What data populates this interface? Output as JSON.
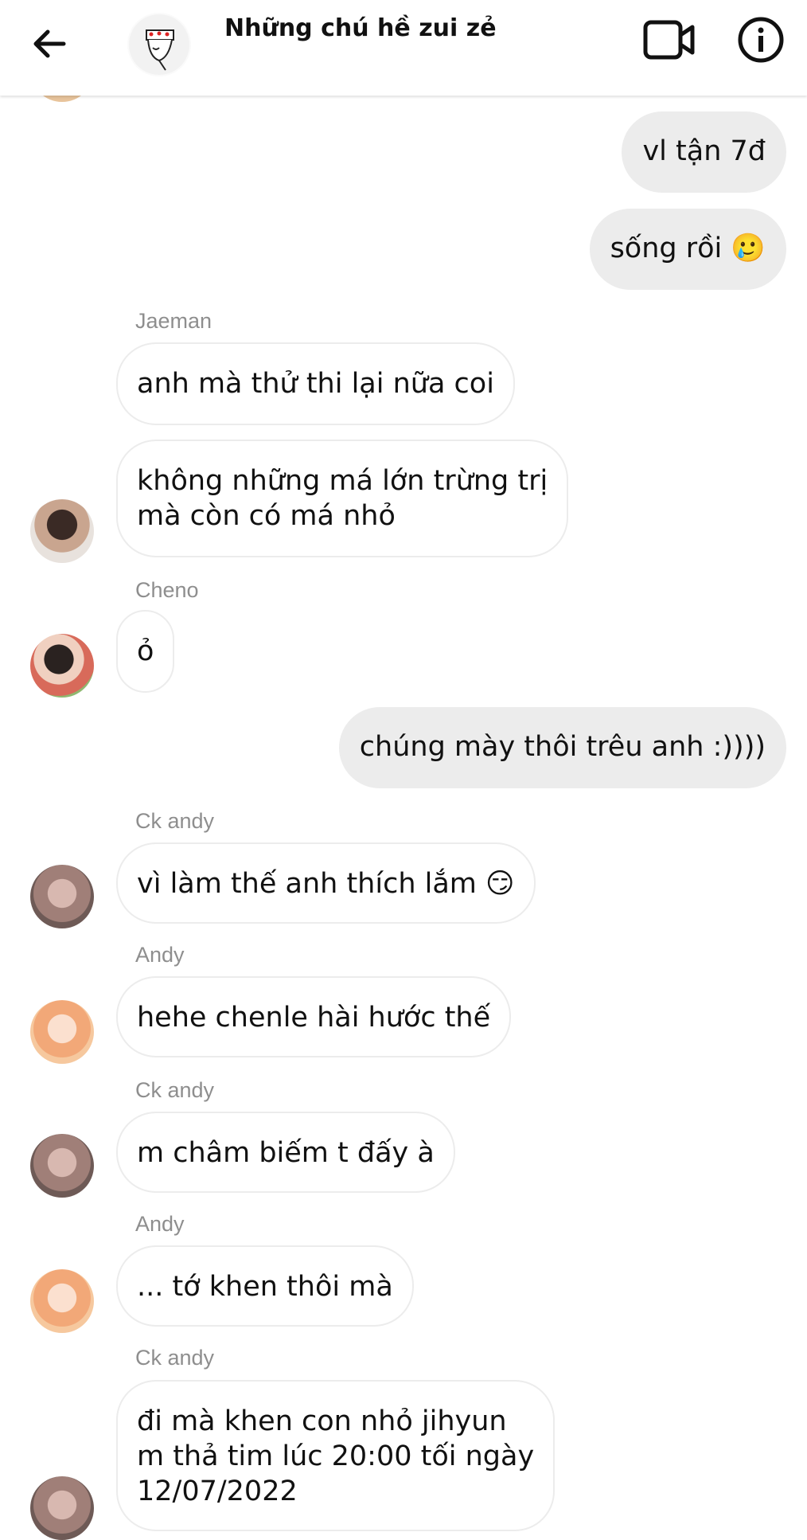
{
  "header": {
    "title": "Những chú hề zui zẻ"
  },
  "messages": [
    {
      "sender": "",
      "text": "vl tận 7đ",
      "outgoing": true
    },
    {
      "sender": "",
      "text": "sống rồi",
      "emoji": "🥲",
      "outgoing": true
    },
    {
      "sender": "Jaeman",
      "text": "anh mà thử thi lại nữa coi",
      "outgoing": false
    },
    {
      "sender": "",
      "line1": "không những má lớn trừng trị",
      "line2": "mà còn có má nhỏ",
      "outgoing": false
    },
    {
      "sender": "Cheno",
      "text": "ỏ",
      "outgoing": false
    },
    {
      "sender": "",
      "text": "chúng mày thôi trêu anh :))))",
      "outgoing": true
    },
    {
      "sender": "Ck andy",
      "text": "vì làm thế anh thích lắm",
      "emoji": "😏",
      "outgoing": false
    },
    {
      "sender": "Andy",
      "text": "hehe chenle hài hước thế",
      "outgoing": false
    },
    {
      "sender": "Ck andy",
      "text": "m châm biếm t đấy à",
      "outgoing": false
    },
    {
      "sender": "Andy",
      "text": "... tớ khen thôi mà",
      "outgoing": false
    },
    {
      "sender": "Ck andy",
      "line1": "đi mà khen con nhỏ jihyun",
      "line2": "m thả tim lúc 20:00 tối ngày",
      "line3": "12/07/2022",
      "outgoing": false
    }
  ]
}
